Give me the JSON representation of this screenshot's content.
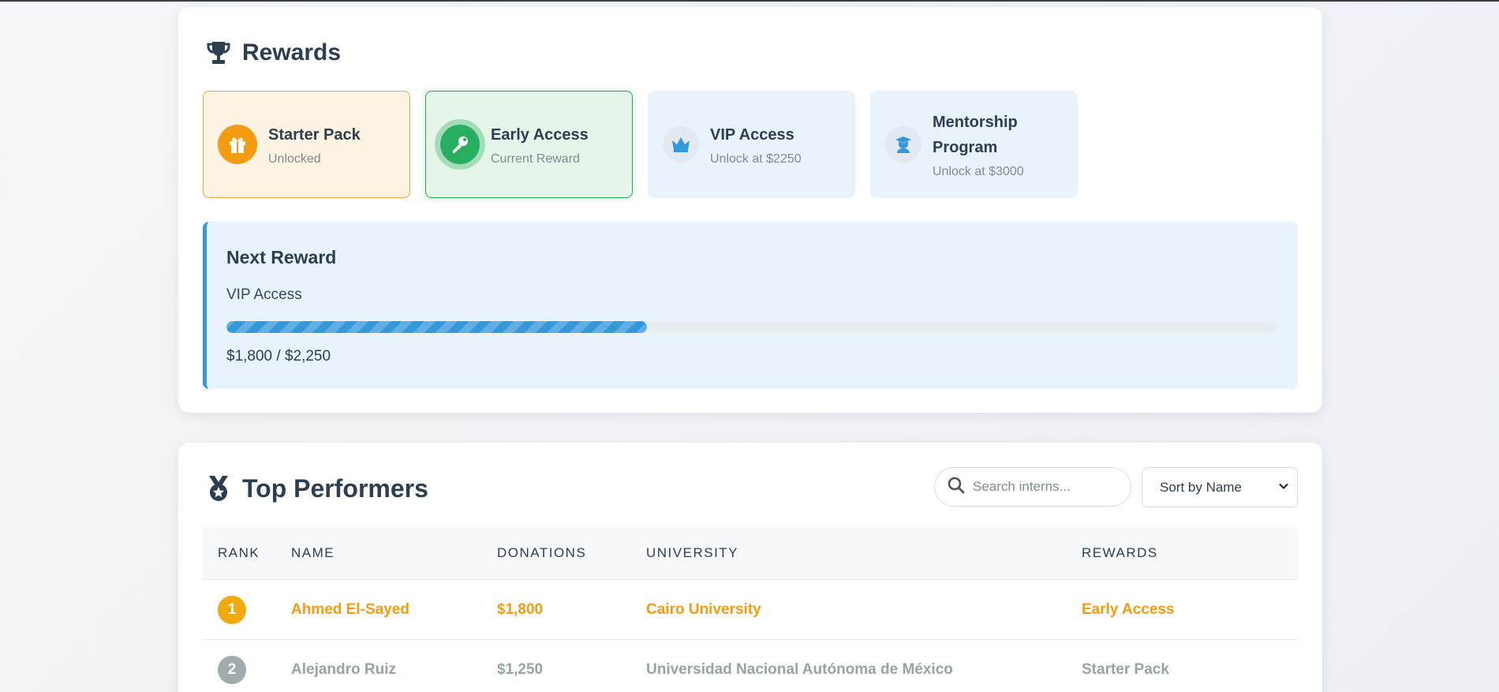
{
  "rewards": {
    "title": "Rewards",
    "tiers": [
      {
        "name": "Starter Pack",
        "status": "Unlocked",
        "icon": "gift-icon"
      },
      {
        "name": "Early Access",
        "status": "Current Reward",
        "icon": "key-icon"
      },
      {
        "name": "VIP Access",
        "status": "Unlock at $2250",
        "icon": "crown-icon"
      },
      {
        "name": "Mentorship",
        "name2": "Program",
        "status": "Unlock at $3000",
        "icon": "graduate-icon"
      }
    ],
    "next": {
      "title": "Next Reward",
      "name": "VIP Access",
      "progress_text": "$1,800 / $2,250",
      "progress_fraction": 0.4
    }
  },
  "performers": {
    "title": "Top Performers",
    "search_placeholder": "Search interns...",
    "sort_label": "Sort by Name",
    "columns": [
      "RANK",
      "NAME",
      "DONATIONS",
      "UNIVERSITY",
      "REWARDS"
    ],
    "rows": [
      {
        "rank": "1",
        "name": "Ahmed El-Sayed",
        "donations": "$1,800",
        "university": "Cairo University",
        "reward": "Early Access"
      },
      {
        "rank": "2",
        "name": "Alejandro Ruiz",
        "donations": "$1,250",
        "university": "Universidad Nacional Autónoma de México",
        "reward": "Starter Pack"
      }
    ]
  },
  "colors": {
    "accent": "#3498db",
    "gold": "#f39c12",
    "green": "#27ae60",
    "silver": "#95a5a6",
    "text": "#2c3e50"
  }
}
